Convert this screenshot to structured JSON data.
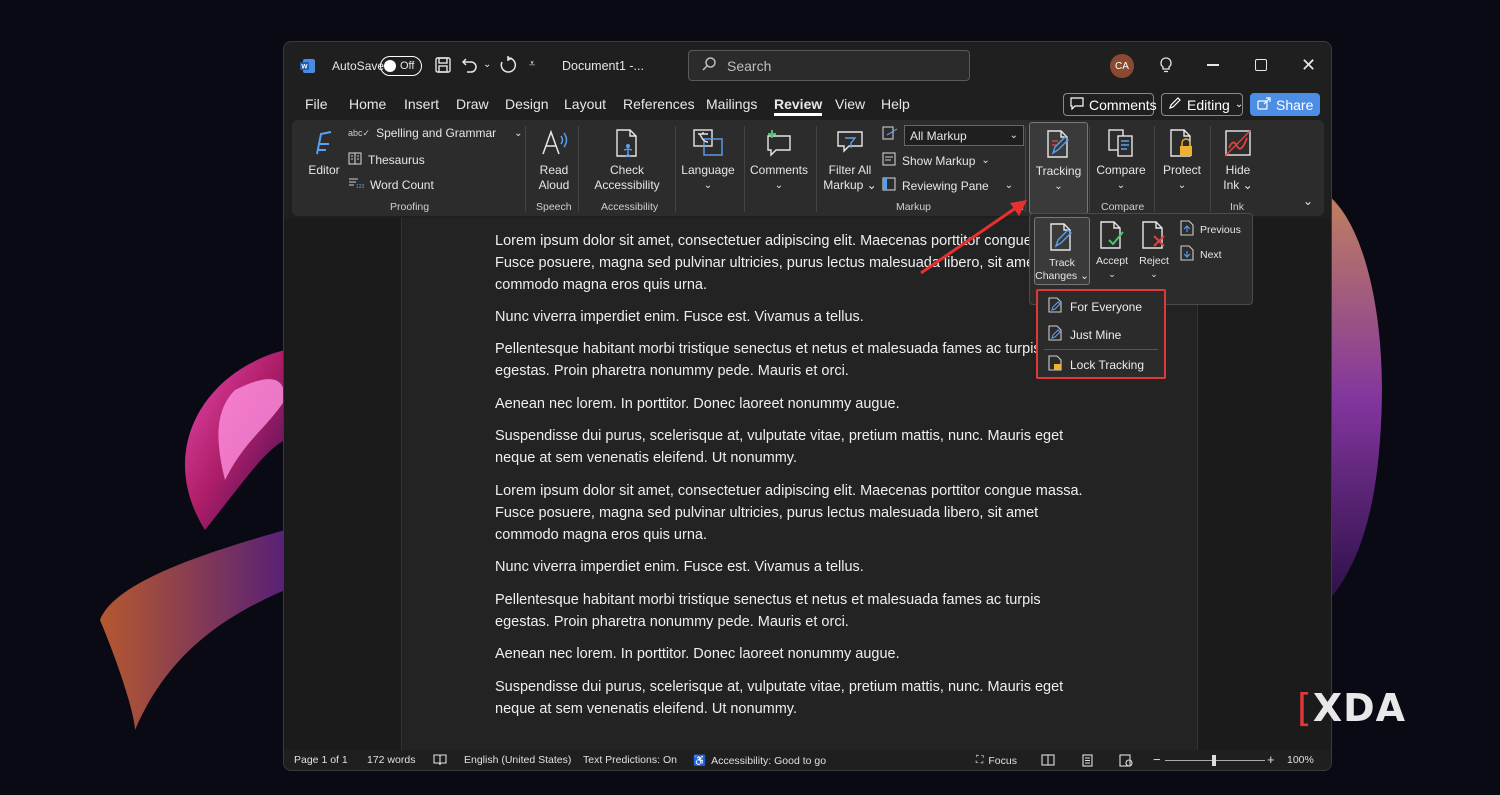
{
  "window": {
    "app_icon": "word-icon",
    "autosave_label": "AutoSave",
    "autosave_state": "Off",
    "document_title": "Document1  -...",
    "search_placeholder": "Search",
    "user_initials": "CA"
  },
  "menubar": {
    "tabs": [
      "File",
      "Home",
      "Insert",
      "Draw",
      "Design",
      "Layout",
      "References",
      "Mailings",
      "Review",
      "View",
      "Help"
    ],
    "active_tab": "Review",
    "comments_label": "Comments",
    "editing_label": "Editing",
    "share_label": "Share"
  },
  "ribbon": {
    "editor": "Editor",
    "spelling": "Spelling and Grammar",
    "thesaurus": "Thesaurus",
    "word_count": "Word Count",
    "proofing": "Proofing",
    "read_aloud_1": "Read",
    "read_aloud_2": "Aloud",
    "speech": "Speech",
    "check_1": "Check",
    "check_2": "Accessibility",
    "accessibility": "Accessibility",
    "language": "Language",
    "comments": "Comments",
    "filter_1": "Filter All",
    "filter_2": "Markup",
    "all_markup": "All Markup",
    "show_markup": "Show Markup",
    "reviewing_pane": "Reviewing Pane",
    "markup": "Markup",
    "tracking": "Tracking",
    "compare": "Compare",
    "compare_group": "Compare",
    "protect": "Protect",
    "hide_ink_1": "Hide",
    "hide_ink_2": "Ink",
    "ink": "Ink"
  },
  "tracking_popup": {
    "track_1": "Track",
    "track_2": "Changes",
    "accept": "Accept",
    "reject": "Reject",
    "previous": "Previous",
    "next": "Next"
  },
  "track_dropdown": {
    "for_everyone": "For Everyone",
    "just_mine": "Just Mine",
    "lock_tracking": "Lock Tracking"
  },
  "document": {
    "paragraphs": [
      "Lorem ipsum dolor sit amet, consectetuer adipiscing elit. Maecenas porttitor congue massa. Fusce posuere, magna sed pulvinar ultricies, purus lectus malesuada libero, sit amet commodo magna eros quis urna.",
      "Nunc viverra imperdiet enim. Fusce est. Vivamus a tellus.",
      "Pellentesque habitant morbi tristique senectus et netus et malesuada fames ac turpis egestas. Proin pharetra nonummy pede. Mauris et orci.",
      "Aenean nec lorem. In porttitor. Donec laoreet nonummy augue.",
      "Suspendisse dui purus, scelerisque at, vulputate vitae, pretium mattis, nunc. Mauris eget neque at sem venenatis eleifend. Ut nonummy.",
      "Lorem ipsum dolor sit amet, consectetuer adipiscing elit. Maecenas porttitor congue massa. Fusce posuere, magna sed pulvinar ultricies, purus lectus malesuada libero, sit amet commodo magna eros quis urna.",
      "Nunc viverra imperdiet enim. Fusce est. Vivamus a tellus.",
      "Pellentesque habitant morbi tristique senectus et netus et malesuada fames ac turpis egestas. Proin pharetra nonummy pede. Mauris et orci.",
      "Aenean nec lorem. In porttitor. Donec laoreet nonummy augue.",
      "Suspendisse dui purus, scelerisque at, vulputate vitae, pretium mattis, nunc. Mauris eget neque at sem venenatis eleifend. Ut nonummy."
    ]
  },
  "statusbar": {
    "page": "Page 1 of 1",
    "words": "172 words",
    "language": "English (United States)",
    "predictions": "Text Predictions: On",
    "accessibility": "Accessibility: Good to go",
    "focus": "Focus",
    "zoom": "100%"
  },
  "watermark": "XDA",
  "colors": {
    "accent": "#4c8ee6",
    "highlight": "#e03838",
    "ribbon_bg": "#2c2c2c"
  }
}
